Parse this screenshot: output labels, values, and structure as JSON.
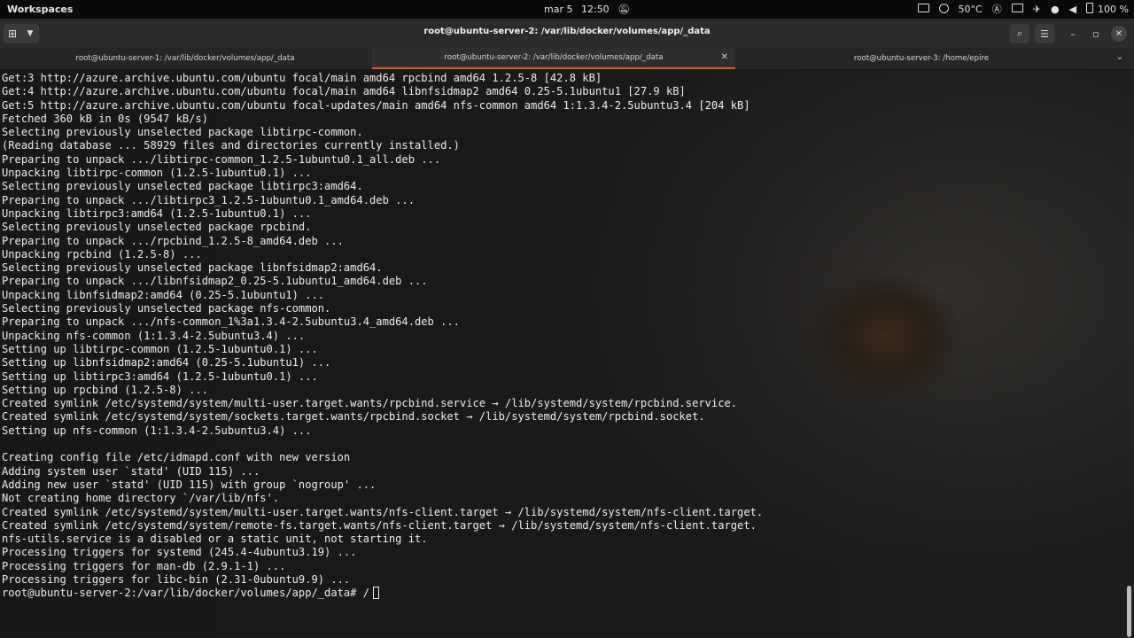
{
  "topbar": {
    "workspaces": "Workspaces",
    "date": "mar 5",
    "time": "12:50",
    "temperature": "50°C",
    "battery": "100 %"
  },
  "window": {
    "title": "root@ubuntu-server-2: /var/lib/docker/volumes/app/_data"
  },
  "tabs": [
    {
      "label": "root@ubuntu-server-1: /var/lib/docker/volumes/app/_data",
      "active": false
    },
    {
      "label": "root@ubuntu-server-2: /var/lib/docker/volumes/app/_data",
      "active": true
    },
    {
      "label": "root@ubuntu-server-3: /home/epire",
      "active": false
    }
  ],
  "terminal": {
    "lines": [
      "Get:3 http://azure.archive.ubuntu.com/ubuntu focal/main amd64 rpcbind amd64 1.2.5-8 [42.8 kB]",
      "Get:4 http://azure.archive.ubuntu.com/ubuntu focal/main amd64 libnfsidmap2 amd64 0.25-5.1ubuntu1 [27.9 kB]",
      "Get:5 http://azure.archive.ubuntu.com/ubuntu focal-updates/main amd64 nfs-common amd64 1:1.3.4-2.5ubuntu3.4 [204 kB]",
      "Fetched 360 kB in 0s (9547 kB/s)",
      "Selecting previously unselected package libtirpc-common.",
      "(Reading database ... 58929 files and directories currently installed.)",
      "Preparing to unpack .../libtirpc-common_1.2.5-1ubuntu0.1_all.deb ...",
      "Unpacking libtirpc-common (1.2.5-1ubuntu0.1) ...",
      "Selecting previously unselected package libtirpc3:amd64.",
      "Preparing to unpack .../libtirpc3_1.2.5-1ubuntu0.1_amd64.deb ...",
      "Unpacking libtirpc3:amd64 (1.2.5-1ubuntu0.1) ...",
      "Selecting previously unselected package rpcbind.",
      "Preparing to unpack .../rpcbind_1.2.5-8_amd64.deb ...",
      "Unpacking rpcbind (1.2.5-8) ...",
      "Selecting previously unselected package libnfsidmap2:amd64.",
      "Preparing to unpack .../libnfsidmap2_0.25-5.1ubuntu1_amd64.deb ...",
      "Unpacking libnfsidmap2:amd64 (0.25-5.1ubuntu1) ...",
      "Selecting previously unselected package nfs-common.",
      "Preparing to unpack .../nfs-common_1%3a1.3.4-2.5ubuntu3.4_amd64.deb ...",
      "Unpacking nfs-common (1:1.3.4-2.5ubuntu3.4) ...",
      "Setting up libtirpc-common (1.2.5-1ubuntu0.1) ...",
      "Setting up libnfsidmap2:amd64 (0.25-5.1ubuntu1) ...",
      "Setting up libtirpc3:amd64 (1.2.5-1ubuntu0.1) ...",
      "Setting up rpcbind (1.2.5-8) ...",
      "Created symlink /etc/systemd/system/multi-user.target.wants/rpcbind.service → /lib/systemd/system/rpcbind.service.",
      "Created symlink /etc/systemd/system/sockets.target.wants/rpcbind.socket → /lib/systemd/system/rpcbind.socket.",
      "Setting up nfs-common (1:1.3.4-2.5ubuntu3.4) ...",
      "",
      "Creating config file /etc/idmapd.conf with new version",
      "Adding system user `statd' (UID 115) ...",
      "Adding new user `statd' (UID 115) with group `nogroup' ...",
      "Not creating home directory `/var/lib/nfs'.",
      "Created symlink /etc/systemd/system/multi-user.target.wants/nfs-client.target → /lib/systemd/system/nfs-client.target.",
      "Created symlink /etc/systemd/system/remote-fs.target.wants/nfs-client.target → /lib/systemd/system/nfs-client.target.",
      "nfs-utils.service is a disabled or a static unit, not starting it.",
      "Processing triggers for systemd (245.4-4ubuntu3.19) ...",
      "Processing triggers for man-db (2.9.1-1) ...",
      "Processing triggers for libc-bin (2.31-0ubuntu9.9) ..."
    ],
    "prompt": "root@ubuntu-server-2:/var/lib/docker/volumes/app/_data# ",
    "input": "/"
  }
}
